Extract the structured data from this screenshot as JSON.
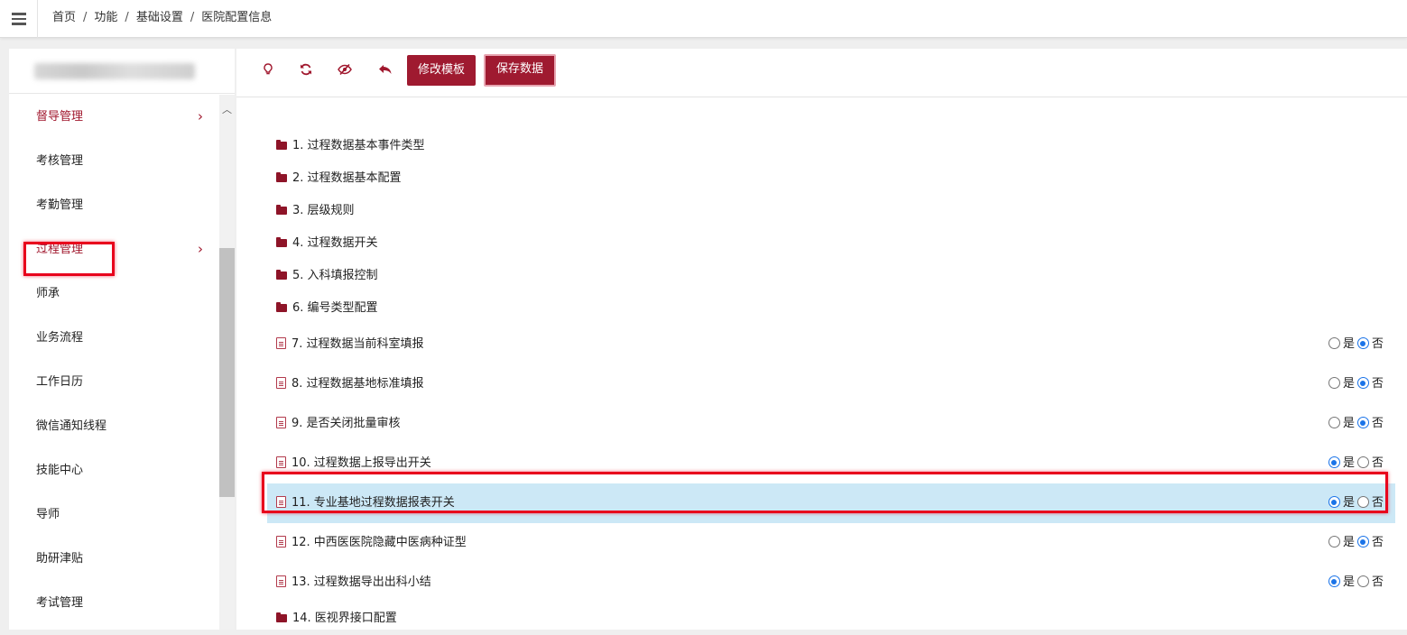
{
  "breadcrumb": [
    "首页",
    "功能",
    "基础设置",
    "医院配置信息"
  ],
  "sidebar": {
    "items": [
      {
        "label": "督导管理",
        "chevron": "›",
        "active": true
      },
      {
        "label": "考核管理"
      },
      {
        "label": "考勤管理"
      },
      {
        "label": "过程管理",
        "chevron": "›",
        "active": true
      },
      {
        "label": "师承"
      },
      {
        "label": "业务流程"
      },
      {
        "label": "工作日历"
      },
      {
        "label": "微信通知线程"
      },
      {
        "label": "技能中心"
      },
      {
        "label": "导师"
      },
      {
        "label": "助研津贴"
      },
      {
        "label": "考试管理"
      }
    ]
  },
  "toolbar": {
    "icons": [
      "lightbulb-icon",
      "refresh-icon",
      "eye-slash-icon",
      "undo-icon"
    ],
    "edit_template_label": "修改模板",
    "save_data_label": "保存数据"
  },
  "radio_labels": {
    "yes": "是",
    "no": "否"
  },
  "tree": [
    {
      "label": "1. 过程数据基本事件类型",
      "type": "folder"
    },
    {
      "label": "2. 过程数据基本配置",
      "type": "folder"
    },
    {
      "label": "3. 层级规则",
      "type": "folder"
    },
    {
      "label": "4. 过程数据开关",
      "type": "folder"
    },
    {
      "label": "5. 入科填报控制",
      "type": "folder"
    },
    {
      "label": "6. 编号类型配置",
      "type": "folder"
    },
    {
      "label": "7. 过程数据当前科室填报",
      "type": "leaf",
      "value": "否"
    },
    {
      "label": "8. 过程数据基地标准填报",
      "type": "leaf",
      "value": "否"
    },
    {
      "label": "9. 是否关闭批量审核",
      "type": "leaf",
      "value": "否"
    },
    {
      "label": "10. 过程数据上报导出开关",
      "type": "leaf",
      "value": "是"
    },
    {
      "label": "11. 专业基地过程数据报表开关",
      "type": "leaf",
      "value": "是",
      "selected": true
    },
    {
      "label": "12. 中西医医院隐藏中医病种证型",
      "type": "leaf",
      "value": "否"
    },
    {
      "label": "13. 过程数据导出出科小结",
      "type": "leaf",
      "value": "是"
    },
    {
      "label": "14. 医视界接口配置",
      "type": "folder"
    }
  ],
  "colors": {
    "accent": "#a0172d",
    "radio_on": "#1a73e8",
    "selected_row": "#cce8f6",
    "highlight": "#e8001c"
  }
}
